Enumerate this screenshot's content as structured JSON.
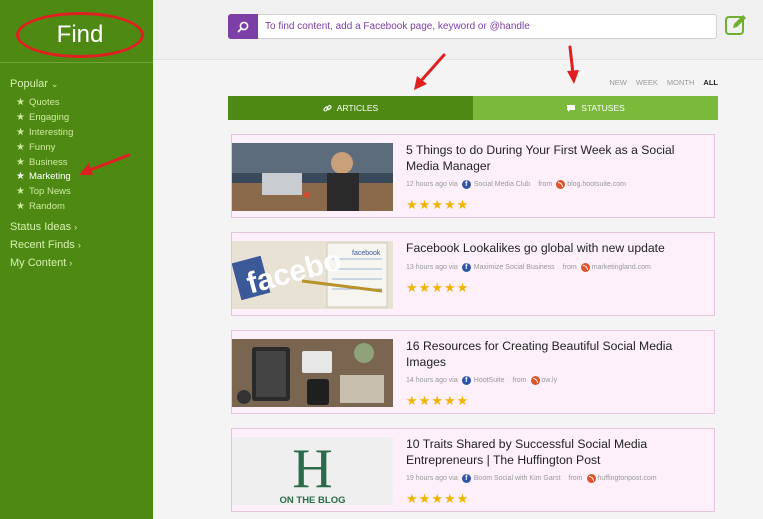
{
  "sidebar": {
    "title": "Find",
    "popular_label": "Popular",
    "popular_items": [
      {
        "label": "Quotes",
        "active": false
      },
      {
        "label": "Engaging",
        "active": false
      },
      {
        "label": "Interesting",
        "active": false
      },
      {
        "label": "Funny",
        "active": false
      },
      {
        "label": "Business",
        "active": false
      },
      {
        "label": "Marketing",
        "active": true
      },
      {
        "label": "Top News",
        "active": false
      },
      {
        "label": "Random",
        "active": false
      }
    ],
    "status_ideas_label": "Status Ideas",
    "recent_finds_label": "Recent Finds",
    "my_content_label": "My Content"
  },
  "search": {
    "placeholder": "To find content, add a Facebook page, keyword or @handle"
  },
  "time_filters": [
    "NEW",
    "WEEK",
    "MONTH",
    "ALL"
  ],
  "time_filter_active": "ALL",
  "tabs": {
    "articles_label": "ARTICLES",
    "statuses_label": "STATUSES"
  },
  "colors": {
    "sidebar_bg": "#4e8a13",
    "accent_purple": "#7b3fa6",
    "tab_articles": "#4e8a13",
    "tab_statuses": "#7ab93a",
    "star": "#f0b400",
    "annotation": "#e02020"
  },
  "articles": [
    {
      "title": "5 Things to do During Your First Week as a Social Media Manager",
      "time": "12 hours ago via",
      "page": "Social Media Club",
      "from_label": "from",
      "source": "blog.hootsuite.com",
      "rating": 5
    },
    {
      "title": "Facebook Lookalikes go global with new update",
      "time": "13 hours ago via",
      "page": "Maximize Social Business",
      "from_label": "from",
      "source": "marketingland.com",
      "rating": 5
    },
    {
      "title": "16 Resources for Creating Beautiful Social Media Images",
      "time": "14 hours ago via",
      "page": "HootSuite",
      "from_label": "from",
      "source": "ow.ly",
      "rating": 5
    },
    {
      "title": "10 Traits Shared by Successful Social Media Entrepreneurs | The Huffington Post",
      "time": "19 hours ago via",
      "page": "Boom Social with Kim Garst",
      "from_label": "from",
      "source": "huffingtonpost.com",
      "rating": 5
    }
  ],
  "thumb_texts": {
    "facebook_notebook": "facebook",
    "facebook_wordmark": "facebo",
    "huffpost_letter": "H",
    "huffpost_caption": "ON THE BLOG"
  }
}
